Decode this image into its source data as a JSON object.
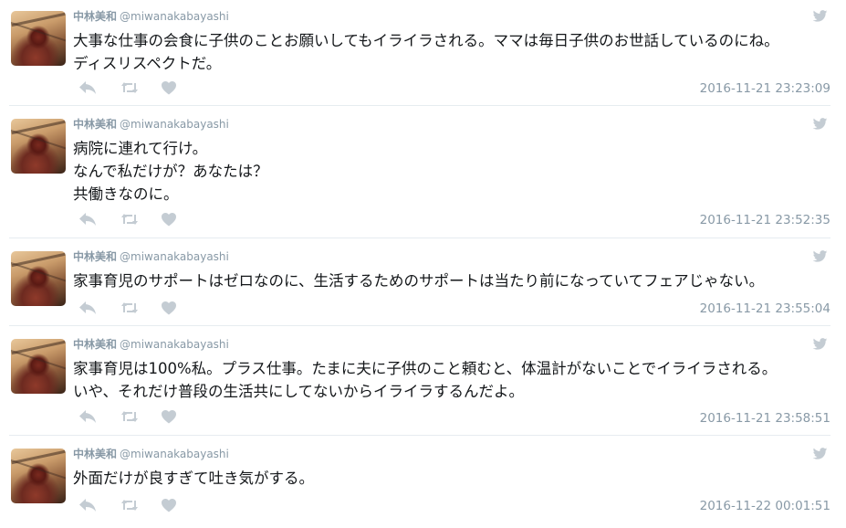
{
  "user": {
    "name": "中林美和",
    "handle": "@miwanakabayashi"
  },
  "icons": {
    "reply": "reply-icon",
    "retweet": "retweet-icon",
    "like": "heart-icon",
    "twitter": "twitter-bird-icon"
  },
  "colors": {
    "muted": "#8899a6",
    "icon": "#c4ccd3",
    "divider": "#e6ecf0",
    "text": "#14171a"
  },
  "tweets": [
    {
      "text": "大事な仕事の会食に子供のことお願いしてもイライラされる。ママは毎日子供のお世話しているのにね。\nディスリスペクトだ。",
      "timestamp": "2016-11-21 23:23:09"
    },
    {
      "text": "病院に連れて行け。\nなんで私だけが？あなたは？\n共働きなのに。",
      "timestamp": "2016-11-21 23:52:35"
    },
    {
      "text": "家事育児のサポートはゼロなのに、生活するためのサポートは当たり前になっていてフェアじゃない。",
      "timestamp": "2016-11-21 23:55:04"
    },
    {
      "text": "家事育児は100%私。プラス仕事。たまに夫に子供のこと頼むと、体温計がないことでイライラされる。\nいや、それだけ普段の生活共にしてないからイライラするんだよ。",
      "timestamp": "2016-11-21 23:58:51"
    },
    {
      "text": "外面だけが良すぎて吐き気がする。",
      "timestamp": "2016-11-22 00:01:51"
    }
  ]
}
